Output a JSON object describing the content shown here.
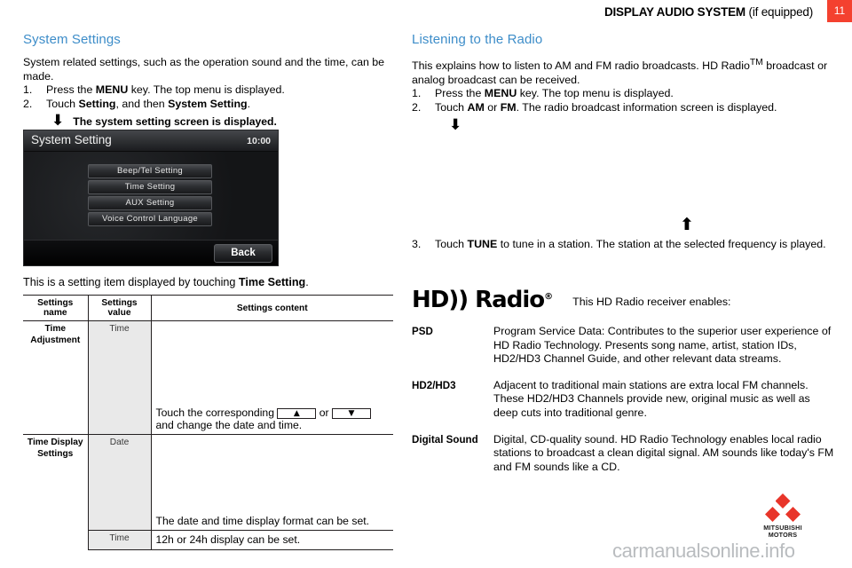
{
  "header": {
    "title_bold": "DISPLAY AUDIO SYSTEM",
    "title_light": "(if equipped)",
    "page_number": "11",
    "badge_color": "#f4412f"
  },
  "left_column": {
    "heading": "System Settings",
    "heading_color": "#3d8dc9",
    "intro": "System related settings, such as the operation sound and the time, can be made.",
    "steps": [
      {
        "num": "1.",
        "pre": "Press the ",
        "bold": "MENU",
        "post": " key. The top menu is displayed."
      },
      {
        "num": "2.",
        "pre": "Touch ",
        "bold": "Setting",
        "mid": ", and then ",
        "bold2": "System Setting",
        "post": "."
      }
    ],
    "arrow_icon": "arrow-down",
    "arrow_caption": "The system setting screen is displayed.",
    "table_intro_pre": "This is a setting item displayed by touching ",
    "table_intro_bold": "Time Setting",
    "table_intro_post": "."
  },
  "device_screen": {
    "title": "System Setting",
    "clock": "10:00",
    "buttons": [
      "Beep/Tel Setting",
      "Time  Setting",
      "AUX  Setting",
      "Voice Control Language"
    ],
    "back_label": "Back"
  },
  "settings_table": {
    "columns": [
      "Settings name",
      "Settings value",
      "Settings content"
    ],
    "rows": [
      {
        "name": "Time\nAdjustment",
        "value": "Time",
        "content_line1_pre": "Touch the corresponding ",
        "content_key_up": "▲",
        "content_mid": " or ",
        "content_key_down": "▼",
        "content_line2": "and change the date and time."
      },
      {
        "name": "Time Display\nSettings",
        "value": "Date",
        "content": "The date and time display format can be set."
      },
      {
        "name": "",
        "value": "Time",
        "content": "12h or 24h display can be set."
      }
    ]
  },
  "right_column": {
    "heading": "Listening to the Radio",
    "heading_color": "#3d8dc9",
    "intro_pre": "This explains how to listen to AM and FM radio broadcasts. HD Radio",
    "intro_sup": "TM",
    "intro_post": " broadcast or analog broadcast can be received.",
    "steps": [
      {
        "num": "1.",
        "pre": "Press the ",
        "bold": "MENU",
        "post": " key. The top menu is displayed."
      },
      {
        "num": "2.",
        "pre": "Touch ",
        "bold": "AM",
        "mid": " or ",
        "bold2": "FM",
        "post": ". The radio broadcast information screen is displayed."
      }
    ],
    "arrow_down_icon": "arrow-down",
    "arrow_up_icon": "arrow-up",
    "step3": {
      "num": "3.",
      "pre": "Touch ",
      "bold": "TUNE",
      "post": " to tune in a station. The station at the selected frequency is played."
    },
    "hd_radio_logo_text": "HD)) Radio",
    "hd_radio_logo_registered": "®",
    "hd_radio_caption": "This HD Radio receiver enables:",
    "features": [
      {
        "term": "PSD",
        "desc": "Program Service Data: Contributes to the superior user experience of HD Radio Technology. Presents song name, artist, station IDs, HD2/HD3 Channel Guide, and other relevant data streams."
      },
      {
        "term": "HD2/HD3",
        "desc": "Adjacent to traditional main stations are extra local FM channels. These HD2/HD3 Channels provide new, original music as well as deep cuts into traditional genre."
      },
      {
        "term": "Digital Sound",
        "desc": "Digital, CD-quality sound. HD Radio Technology enables local radio stations to broadcast a clean digital signal. AM sounds like today's FM and FM sounds like a CD."
      }
    ]
  },
  "brand": {
    "name_line1": "MITSUBISHI",
    "name_line2": "MOTORS",
    "diamond_color": "#e8352a"
  },
  "footer": {
    "watermark": "carmanualsonline.info"
  }
}
